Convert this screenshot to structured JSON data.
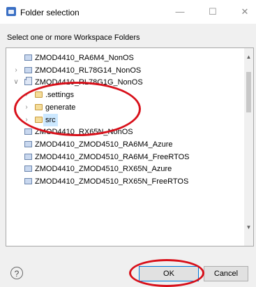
{
  "window": {
    "title": "Folder selection",
    "minimize": "—",
    "maximize": "☐",
    "close": "✕"
  },
  "instruction": "Select one or more Workspace Folders",
  "tree": {
    "items": [
      {
        "label": "ZMOD4410_RA6M4_NonOS",
        "type": "project",
        "level": 0,
        "expanded": false,
        "has_children": false
      },
      {
        "label": "ZMOD4410_RL78G14_NonOS",
        "type": "project",
        "level": 0,
        "expanded": false,
        "has_children": true
      },
      {
        "label": "ZMOD4410_RL78G1G_NonOS",
        "type": "project",
        "level": 0,
        "expanded": true,
        "has_children": true
      },
      {
        "label": ".settings",
        "type": "folder",
        "level": 1,
        "expanded": false,
        "has_children": true
      },
      {
        "label": "generate",
        "type": "folder",
        "level": 1,
        "expanded": false,
        "has_children": true
      },
      {
        "label": "src",
        "type": "folder",
        "level": 1,
        "expanded": false,
        "has_children": true,
        "selected": true
      },
      {
        "label": "ZMOD4410_RX65N_NonOS",
        "type": "project",
        "level": 0,
        "expanded": false,
        "has_children": false
      },
      {
        "label": "ZMOD4410_ZMOD4510_RA6M4_Azure",
        "type": "project",
        "level": 0,
        "expanded": false,
        "has_children": false
      },
      {
        "label": "ZMOD4410_ZMOD4510_RA6M4_FreeRTOS",
        "type": "project",
        "level": 0,
        "expanded": false,
        "has_children": false
      },
      {
        "label": "ZMOD4410_ZMOD4510_RX65N_Azure",
        "type": "project",
        "level": 0,
        "expanded": false,
        "has_children": false
      },
      {
        "label": "ZMOD4410_ZMOD4510_RX65N_FreeRTOS",
        "type": "project",
        "level": 0,
        "expanded": false,
        "has_children": false
      }
    ]
  },
  "scrollbar": {
    "up": "▲",
    "down": "▼"
  },
  "help": {
    "glyph": "?"
  },
  "buttons": {
    "ok": "OK",
    "cancel": "Cancel"
  },
  "colors": {
    "annotation": "#d8101a",
    "selection": "#cce8ff",
    "accent": "#0078d7"
  }
}
